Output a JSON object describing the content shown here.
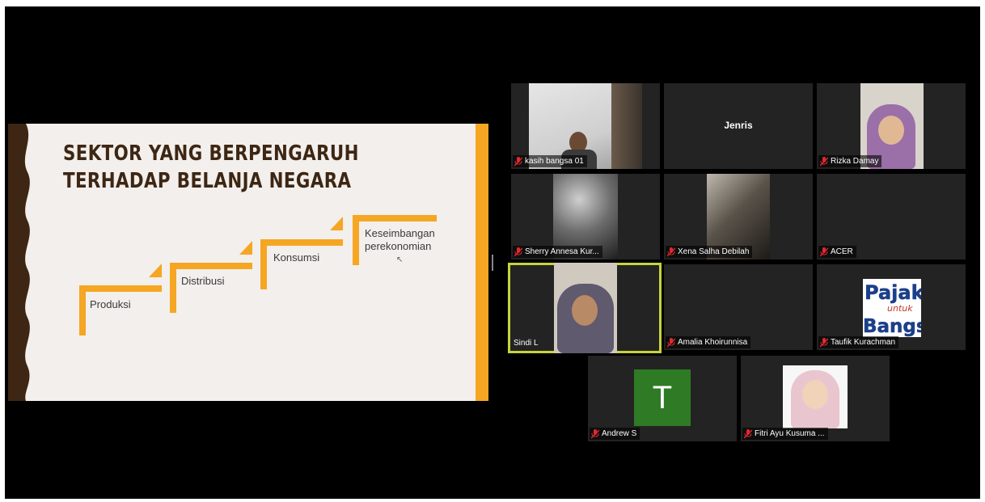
{
  "slide": {
    "title_line1": "SEKTOR YANG BERPENGARUH",
    "title_line2": "TERHADAP BELANJA NEGARA",
    "steps": [
      "Produksi",
      "Distribusi",
      "Konsumsi",
      "Keseimbangan\nperekonomian"
    ],
    "accent_color": "#f5a623",
    "border_color": "#3d2613"
  },
  "participants": [
    {
      "name": "kasih bangsa 01",
      "muted": true,
      "type": "video"
    },
    {
      "name": "Jenris",
      "muted": false,
      "type": "name-only"
    },
    {
      "name": "Rizka Damay",
      "muted": true,
      "type": "video"
    },
    {
      "name": "Sherry Annesa Kur...",
      "muted": true,
      "type": "video"
    },
    {
      "name": "Xena Salha Debilah",
      "muted": true,
      "type": "video"
    },
    {
      "name": "ACER",
      "muted": true,
      "type": "blank"
    },
    {
      "name": "Sindi L",
      "muted": false,
      "type": "video",
      "active_speaker": true
    },
    {
      "name": "Amalia Khoirunnisa",
      "muted": true,
      "type": "blank"
    },
    {
      "name": "Taufik Kurachman",
      "muted": true,
      "type": "logo"
    },
    {
      "name": "Andrew S",
      "muted": true,
      "type": "avatar",
      "initial": "T"
    },
    {
      "name": "Fitri Ayu Kusuma ...",
      "muted": true,
      "type": "photo"
    }
  ],
  "logo_text": {
    "line1": "Pajak",
    "line2": "untuk",
    "line3": "Bangsa"
  },
  "colors": {
    "active_outline": "#c8d43a",
    "muted_icon": "#e0282e",
    "avatar_bg": "#2f7a25",
    "tile_bg": "#232323"
  }
}
